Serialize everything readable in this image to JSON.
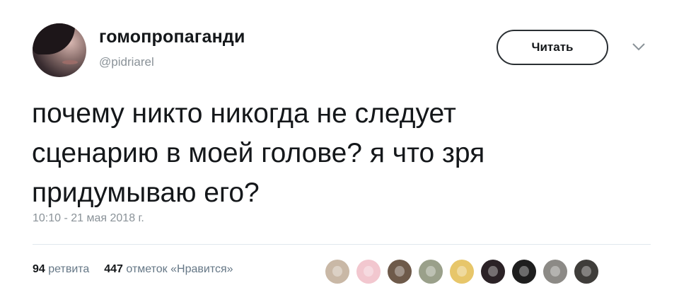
{
  "user": {
    "display_name": "гомопропаганди",
    "handle": "@pidriarel"
  },
  "follow_button": {
    "label": "Читать"
  },
  "tweet": {
    "lines": [
      "почему никто никогда не следует",
      "сценарию в моей голове? я что зря",
      "придумываю его?"
    ],
    "timestamp": "10:10 - 21 мая 2018 г."
  },
  "stats": {
    "retweets_count": "94",
    "retweets_label": "ретвита",
    "likes_count": "447",
    "likes_label": "отметок «Нравится»"
  },
  "likers": [
    {
      "icon": "liker-avatar",
      "color": "#c9b8a6"
    },
    {
      "icon": "liker-avatar",
      "color": "#f2c7cf"
    },
    {
      "icon": "liker-avatar",
      "color": "#6e5a4a"
    },
    {
      "icon": "liker-avatar",
      "color": "#9aa08a"
    },
    {
      "icon": "liker-avatar",
      "color": "#e7c66a"
    },
    {
      "icon": "liker-avatar",
      "color": "#2b2226"
    },
    {
      "icon": "liker-avatar",
      "color": "#1e1e1e"
    },
    {
      "icon": "liker-avatar",
      "color": "#8c8a86"
    },
    {
      "icon": "liker-avatar",
      "color": "#3f3d3a"
    }
  ],
  "colors": {
    "text": "#14171a",
    "secondary": "#8a9298",
    "divider": "#e1e8ed"
  }
}
